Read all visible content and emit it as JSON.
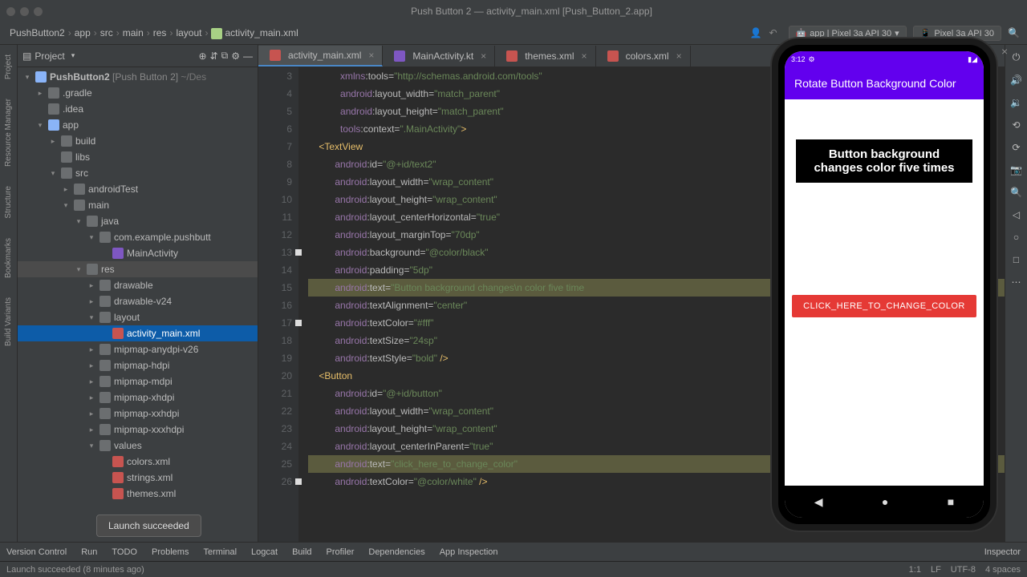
{
  "window": {
    "title": "Push Button 2 — activity_main.xml [Push_Button_2.app]"
  },
  "breadcrumbs": [
    "PushButton2",
    "app",
    "src",
    "main",
    "res",
    "layout",
    "activity_main.xml"
  ],
  "run_configs": [
    {
      "label": "app | Pixel 3a API 30"
    },
    {
      "label": "Pixel 3a API 30"
    }
  ],
  "project": {
    "title": "Project",
    "root": "PushButton2",
    "root_suffix": "[Push Button 2]",
    "root_path": "~/Des",
    "nodes": [
      {
        "d": 1,
        "e": "▸",
        "i": "folder",
        "l": ".gradle"
      },
      {
        "d": 1,
        "e": "",
        "i": "folder",
        "l": ".idea"
      },
      {
        "d": 1,
        "e": "▾",
        "i": "mod",
        "l": "app"
      },
      {
        "d": 2,
        "e": "▸",
        "i": "folder",
        "l": "build"
      },
      {
        "d": 2,
        "e": "",
        "i": "folder",
        "l": "libs"
      },
      {
        "d": 2,
        "e": "▾",
        "i": "folder",
        "l": "src"
      },
      {
        "d": 3,
        "e": "▸",
        "i": "folder",
        "l": "androidTest"
      },
      {
        "d": 3,
        "e": "▾",
        "i": "folder",
        "l": "main"
      },
      {
        "d": 4,
        "e": "▾",
        "i": "folder",
        "l": "java"
      },
      {
        "d": 5,
        "e": "▾",
        "i": "folder",
        "l": "com.example.pushbutt"
      },
      {
        "d": 6,
        "e": "",
        "i": "kt",
        "l": "MainActivity"
      },
      {
        "d": 4,
        "e": "▾",
        "i": "folder",
        "l": "res",
        "hl": true
      },
      {
        "d": 5,
        "e": "▸",
        "i": "folder",
        "l": "drawable"
      },
      {
        "d": 5,
        "e": "▸",
        "i": "folder",
        "l": "drawable-v24"
      },
      {
        "d": 5,
        "e": "▾",
        "i": "folder",
        "l": "layout"
      },
      {
        "d": 6,
        "e": "",
        "i": "xml",
        "l": "activity_main.xml",
        "sel": true
      },
      {
        "d": 5,
        "e": "▸",
        "i": "folder",
        "l": "mipmap-anydpi-v26"
      },
      {
        "d": 5,
        "e": "▸",
        "i": "folder",
        "l": "mipmap-hdpi"
      },
      {
        "d": 5,
        "e": "▸",
        "i": "folder",
        "l": "mipmap-mdpi"
      },
      {
        "d": 5,
        "e": "▸",
        "i": "folder",
        "l": "mipmap-xhdpi"
      },
      {
        "d": 5,
        "e": "▸",
        "i": "folder",
        "l": "mipmap-xxhdpi"
      },
      {
        "d": 5,
        "e": "▸",
        "i": "folder",
        "l": "mipmap-xxxhdpi"
      },
      {
        "d": 5,
        "e": "▾",
        "i": "folder",
        "l": "values"
      },
      {
        "d": 6,
        "e": "",
        "i": "xml",
        "l": "colors.xml"
      },
      {
        "d": 6,
        "e": "",
        "i": "xml",
        "l": "strings.xml"
      },
      {
        "d": 6,
        "e": "",
        "i": "xml",
        "l": "themes.xml"
      }
    ]
  },
  "tabs": [
    {
      "label": "activity_main.xml",
      "icon": "xml",
      "active": true
    },
    {
      "label": "MainActivity.kt",
      "icon": "kt"
    },
    {
      "label": "themes.xml",
      "icon": "xml"
    },
    {
      "label": "colors.xml",
      "icon": "xml"
    }
  ],
  "gutter_start": 3,
  "gutter_end": 26,
  "breakpoints": [
    13,
    17,
    26
  ],
  "code": [
    {
      "i": "            ",
      "p": [
        [
          "xmlns",
          "ns"
        ],
        [
          ":",
          "attr"
        ],
        [
          "tools",
          "attr"
        ],
        [
          "=",
          "attr"
        ],
        [
          "\"http://schemas.android.com/tools\"",
          "val"
        ]
      ]
    },
    {
      "i": "            ",
      "p": [
        [
          "android",
          "ns"
        ],
        [
          ":",
          "attr"
        ],
        [
          "layout_width",
          "attr"
        ],
        [
          "=",
          "attr"
        ],
        [
          "\"match_parent\"",
          "val"
        ]
      ]
    },
    {
      "i": "            ",
      "p": [
        [
          "android",
          "ns"
        ],
        [
          ":",
          "attr"
        ],
        [
          "layout_height",
          "attr"
        ],
        [
          "=",
          "attr"
        ],
        [
          "\"match_parent\"",
          "val"
        ]
      ]
    },
    {
      "i": "            ",
      "p": [
        [
          "tools",
          "ns"
        ],
        [
          ":",
          "attr"
        ],
        [
          "context",
          "attr"
        ],
        [
          "=",
          "attr"
        ],
        [
          "\".MainActivity\"",
          "val"
        ],
        [
          ">",
          "tag"
        ]
      ]
    },
    {
      "i": "    ",
      "p": [
        [
          "<TextView",
          "tag"
        ]
      ]
    },
    {
      "i": "          ",
      "p": [
        [
          "android",
          "ns"
        ],
        [
          ":",
          "attr"
        ],
        [
          "id",
          "attr"
        ],
        [
          "=",
          "attr"
        ],
        [
          "\"@+id/text2\"",
          "val"
        ]
      ]
    },
    {
      "i": "          ",
      "p": [
        [
          "android",
          "ns"
        ],
        [
          ":",
          "attr"
        ],
        [
          "layout_width",
          "attr"
        ],
        [
          "=",
          "attr"
        ],
        [
          "\"wrap_content\"",
          "val"
        ]
      ]
    },
    {
      "i": "          ",
      "p": [
        [
          "android",
          "ns"
        ],
        [
          ":",
          "attr"
        ],
        [
          "layout_height",
          "attr"
        ],
        [
          "=",
          "attr"
        ],
        [
          "\"wrap_content\"",
          "val"
        ]
      ]
    },
    {
      "i": "          ",
      "p": [
        [
          "android",
          "ns"
        ],
        [
          ":",
          "attr"
        ],
        [
          "layout_centerHorizontal",
          "attr"
        ],
        [
          "=",
          "attr"
        ],
        [
          "\"true\"",
          "val"
        ]
      ]
    },
    {
      "i": "          ",
      "p": [
        [
          "android",
          "ns"
        ],
        [
          ":",
          "attr"
        ],
        [
          "layout_marginTop",
          "attr"
        ],
        [
          "=",
          "attr"
        ],
        [
          "\"70dp\"",
          "val"
        ]
      ]
    },
    {
      "i": "          ",
      "p": [
        [
          "android",
          "ns"
        ],
        [
          ":",
          "attr"
        ],
        [
          "background",
          "attr"
        ],
        [
          "=",
          "attr"
        ],
        [
          "\"@color/black\"",
          "val"
        ]
      ]
    },
    {
      "i": "          ",
      "p": [
        [
          "android",
          "ns"
        ],
        [
          ":",
          "attr"
        ],
        [
          "padding",
          "attr"
        ],
        [
          "=",
          "attr"
        ],
        [
          "\"5dp\"",
          "val"
        ]
      ]
    },
    {
      "i": "          ",
      "sel": true,
      "p": [
        [
          "android",
          "ns"
        ],
        [
          ":",
          "attr"
        ],
        [
          "text",
          "attr"
        ],
        [
          "=",
          "attr"
        ],
        [
          "\"Button background changes\\n color five time",
          "val"
        ]
      ]
    },
    {
      "i": "          ",
      "p": [
        [
          "android",
          "ns"
        ],
        [
          ":",
          "attr"
        ],
        [
          "textAlignment",
          "attr"
        ],
        [
          "=",
          "attr"
        ],
        [
          "\"center\"",
          "val"
        ]
      ]
    },
    {
      "i": "          ",
      "p": [
        [
          "android",
          "ns"
        ],
        [
          ":",
          "attr"
        ],
        [
          "textColor",
          "attr"
        ],
        [
          "=",
          "attr"
        ],
        [
          "\"#fff\"",
          "val"
        ]
      ]
    },
    {
      "i": "          ",
      "p": [
        [
          "android",
          "ns"
        ],
        [
          ":",
          "attr"
        ],
        [
          "textSize",
          "attr"
        ],
        [
          "=",
          "attr"
        ],
        [
          "\"24sp\"",
          "val"
        ]
      ]
    },
    {
      "i": "          ",
      "p": [
        [
          "android",
          "ns"
        ],
        [
          ":",
          "attr"
        ],
        [
          "textStyle",
          "attr"
        ],
        [
          "=",
          "attr"
        ],
        [
          "\"bold\"",
          "val"
        ],
        [
          " />",
          "tag"
        ]
      ]
    },
    {
      "i": "    ",
      "p": [
        [
          "<Button",
          "tag"
        ]
      ]
    },
    {
      "i": "          ",
      "p": [
        [
          "android",
          "ns"
        ],
        [
          ":",
          "attr"
        ],
        [
          "id",
          "attr"
        ],
        [
          "=",
          "attr"
        ],
        [
          "\"@+id/button\"",
          "val"
        ]
      ]
    },
    {
      "i": "          ",
      "p": [
        [
          "android",
          "ns"
        ],
        [
          ":",
          "attr"
        ],
        [
          "layout_width",
          "attr"
        ],
        [
          "=",
          "attr"
        ],
        [
          "\"wrap_content\"",
          "val"
        ]
      ]
    },
    {
      "i": "          ",
      "p": [
        [
          "android",
          "ns"
        ],
        [
          ":",
          "attr"
        ],
        [
          "layout_height",
          "attr"
        ],
        [
          "=",
          "attr"
        ],
        [
          "\"wrap_content\"",
          "val"
        ]
      ]
    },
    {
      "i": "          ",
      "p": [
        [
          "android",
          "ns"
        ],
        [
          ":",
          "attr"
        ],
        [
          "layout_centerInParent",
          "attr"
        ],
        [
          "=",
          "attr"
        ],
        [
          "\"true\"",
          "val"
        ]
      ]
    },
    {
      "i": "          ",
      "sel": true,
      "p": [
        [
          "android",
          "ns"
        ],
        [
          ":",
          "attr"
        ],
        [
          "text",
          "attr"
        ],
        [
          "=",
          "attr"
        ],
        [
          "\"click_here_to_change_color\"",
          "val"
        ]
      ]
    },
    {
      "i": "          ",
      "p": [
        [
          "android",
          "ns"
        ],
        [
          ":",
          "attr"
        ],
        [
          "textColor",
          "attr"
        ],
        [
          "=",
          "attr"
        ],
        [
          "\"@color/white\"",
          "val"
        ],
        [
          " />",
          "tag"
        ]
      ]
    }
  ],
  "left_tools": [
    "Project",
    "Resource Manager",
    "Structure",
    "Bookmarks",
    "Build Variants"
  ],
  "bottom": [
    "Version Control",
    "Run",
    "TODO",
    "Problems",
    "Terminal",
    "Logcat",
    "Build",
    "Profiler",
    "Dependencies",
    "App Inspection"
  ],
  "status": {
    "left": "Launch succeeded (8 minutes ago)",
    "right": [
      "1:1",
      "LF",
      "UTF-8",
      "4 spaces"
    ]
  },
  "toast": "Launch succeeded",
  "emulator": {
    "time": "3:12",
    "app_title": "Rotate Button Background Color",
    "text_label": "Button background changes color five times",
    "button_label": "CLICK_HERE_TO_CHANGE_COLOR"
  }
}
